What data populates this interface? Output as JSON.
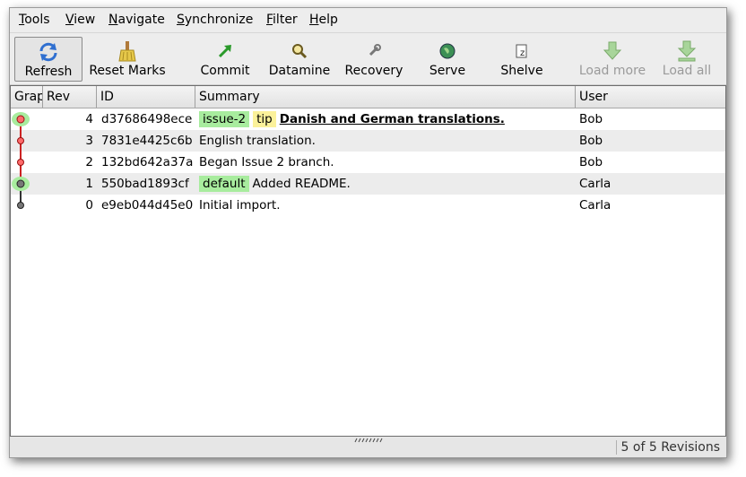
{
  "menu": {
    "items": [
      {
        "u": "T",
        "rest": "ools"
      },
      {
        "u": "V",
        "rest": "iew"
      },
      {
        "u": "N",
        "rest": "avigate"
      },
      {
        "u": "S",
        "rest": "ynchronize"
      },
      {
        "u": "F",
        "rest": "ilter"
      },
      {
        "u": "H",
        "rest": "elp"
      }
    ]
  },
  "toolbar": {
    "refresh": "Refresh",
    "reset_marks": "Reset Marks",
    "commit": "Commit",
    "datamine": "Datamine",
    "recovery": "Recovery",
    "serve": "Serve",
    "shelve": "Shelve",
    "load_more": "Load more",
    "load_all": "Load all"
  },
  "table": {
    "columns": [
      "Graph",
      "Rev",
      "ID",
      "Summary",
      "User"
    ],
    "rows": [
      {
        "rev": "4",
        "id": "d37686498ece",
        "branch": "issue-2",
        "tip": "tip",
        "summary": "Danish and German translations.",
        "user": "Bob",
        "color": "#ff6b6b"
      },
      {
        "rev": "3",
        "id": "7831e4425c6b",
        "branch": "",
        "tip": "",
        "summary": "English translation.",
        "user": "Bob",
        "color": "#ff6b6b"
      },
      {
        "rev": "2",
        "id": "132bd642a37a",
        "branch": "",
        "tip": "",
        "summary": "Began Issue 2 branch.",
        "user": "Bob",
        "color": "#ff6b6b"
      },
      {
        "rev": "1",
        "id": "550bad1893cf",
        "branch": "default",
        "tip": "",
        "summary": "Added README.",
        "user": "Carla",
        "color": "#777777"
      },
      {
        "rev": "0",
        "id": "e9eb044d45e0",
        "branch": "",
        "tip": "",
        "summary": "Initial import.",
        "user": "Carla",
        "color": "#777777"
      }
    ]
  },
  "status": {
    "text": "5 of 5 Revisions"
  },
  "colors": {
    "branch_tag": "#a8ec9e",
    "tip_tag": "#fbf19a",
    "issue_line": "#cc2222",
    "default_line": "#333333"
  }
}
